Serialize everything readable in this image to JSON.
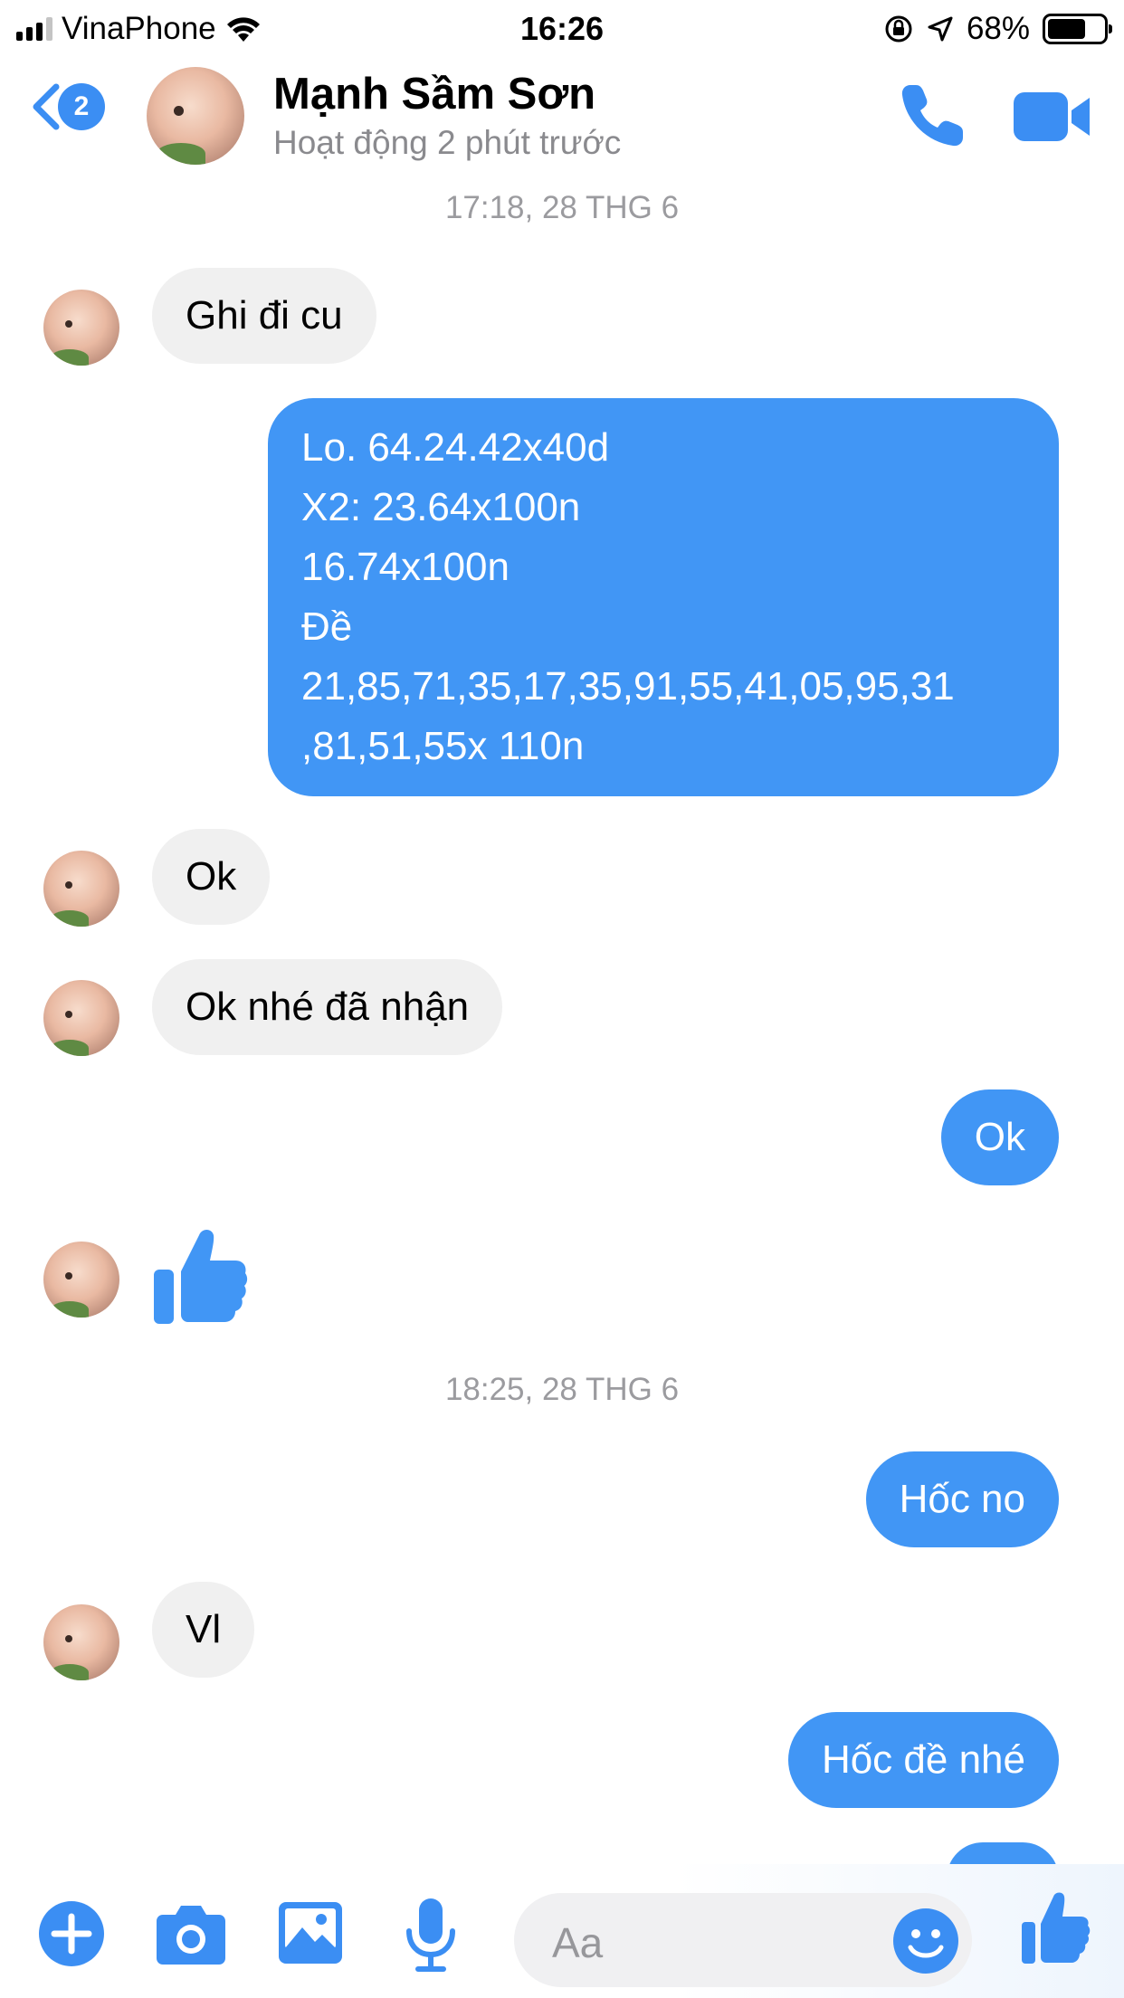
{
  "status_bar": {
    "carrier": "VinaPhone",
    "time": "16:26",
    "battery": "68%",
    "battery_level": 0.68
  },
  "header": {
    "back_badge": "2",
    "contact_name": "Mạnh Sầm Sơn",
    "status": "Hoạt động 2 phút trước"
  },
  "chat": {
    "timestamp_1": "17:18, 28 THG 6",
    "msg_1": "Ghi đi cu",
    "msg_2_lines": [
      "Lo. 64.24.42x40d",
      "X2: 23.64x100n",
      "16.74x100n",
      "Đề",
      "21,85,71,35,17,35,91,55,41,05,95,31",
      ",81,51,55x 110n"
    ],
    "msg_3": "Ok",
    "msg_4": "Ok nhé đã nhận",
    "msg_5": "Ok",
    "timestamp_2": "18:25, 28 THG 6",
    "msg_7": "Hốc no",
    "msg_8": "Vl",
    "msg_9": "Hốc đề nhé"
  },
  "composer": {
    "placeholder": "Aa"
  },
  "colors": {
    "accent": "#4196f5",
    "incoming_bubble": "#f0f0f0",
    "icon_blue": "#3b8ef3"
  }
}
